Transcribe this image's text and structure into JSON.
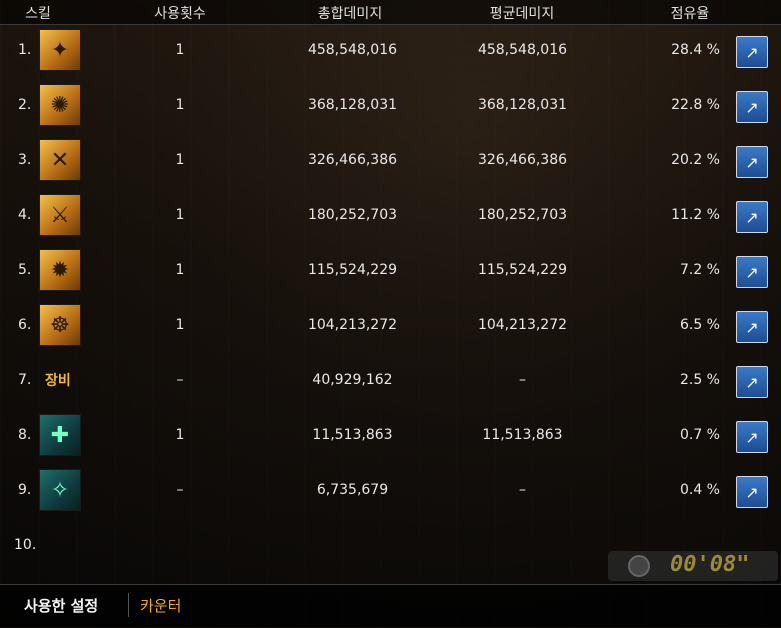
{
  "header": {
    "skill": "스킬",
    "uses": "사용횟수",
    "total_damage": "총합데미지",
    "avg_damage": "평균데미지",
    "share": "점유율"
  },
  "rows": [
    {
      "num": "1.",
      "icon": "skill-icon-1",
      "uses": "1",
      "total": "458,548,016",
      "avg": "458,548,016",
      "share": "28.4 %"
    },
    {
      "num": "2.",
      "icon": "skill-icon-2",
      "uses": "1",
      "total": "368,128,031",
      "avg": "368,128,031",
      "share": "22.8 %"
    },
    {
      "num": "3.",
      "icon": "skill-icon-3",
      "uses": "1",
      "total": "326,466,386",
      "avg": "326,466,386",
      "share": "20.2 %"
    },
    {
      "num": "4.",
      "icon": "skill-icon-4",
      "uses": "1",
      "total": "180,252,703",
      "avg": "180,252,703",
      "share": "11.2 %"
    },
    {
      "num": "5.",
      "icon": "skill-icon-5",
      "uses": "1",
      "total": "115,524,229",
      "avg": "115,524,229",
      "share": "7.2 %"
    },
    {
      "num": "6.",
      "icon": "skill-icon-6",
      "uses": "1",
      "total": "104,213,272",
      "avg": "104,213,272",
      "share": "6.5 %"
    },
    {
      "num": "7.",
      "icon_label": "장비",
      "uses": "–",
      "total": "40,929,162",
      "avg": "–",
      "share": "2.5 %"
    },
    {
      "num": "8.",
      "icon": "skill-icon-8",
      "uses": "1",
      "total": "11,513,863",
      "avg": "11,513,863",
      "share": "0.7 %"
    },
    {
      "num": "9.",
      "icon": "skill-icon-9",
      "uses": "–",
      "total": "6,735,679",
      "avg": "–",
      "share": "0.4 %"
    },
    {
      "num": "10.",
      "uses": "",
      "total": "",
      "avg": "",
      "share": ""
    }
  ],
  "tabs": {
    "used_settings": "사용한 설정",
    "counter": "카운터"
  },
  "timer": "00'08\""
}
